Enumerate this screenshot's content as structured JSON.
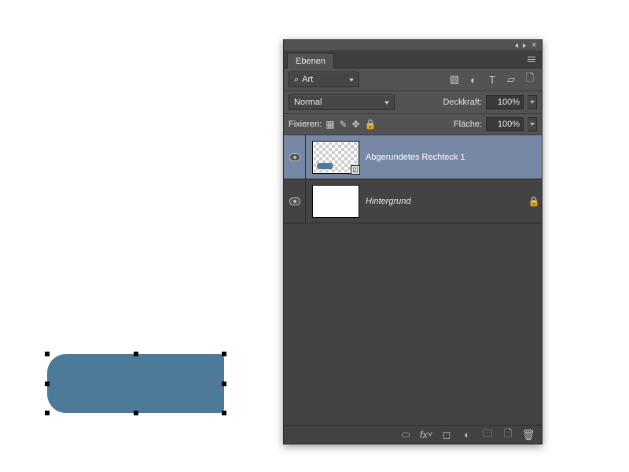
{
  "panel": {
    "tab": "Ebenen",
    "filterLabel": "Art",
    "blendMode": "Normal",
    "opacityLabel": "Deckkraft:",
    "opacityValue": "100%",
    "lockLabel": "Fixieren:",
    "fillLabel": "Fläche:",
    "fillValue": "100%"
  },
  "layers": [
    {
      "name": "Abgerundetes Rechteck 1",
      "selected": true,
      "thumb": "shape",
      "italic": false,
      "locked": false
    },
    {
      "name": "Hintergrund",
      "selected": false,
      "thumb": "white",
      "italic": true,
      "locked": true
    }
  ],
  "canvasShape": {
    "color": "#4d7a99"
  }
}
